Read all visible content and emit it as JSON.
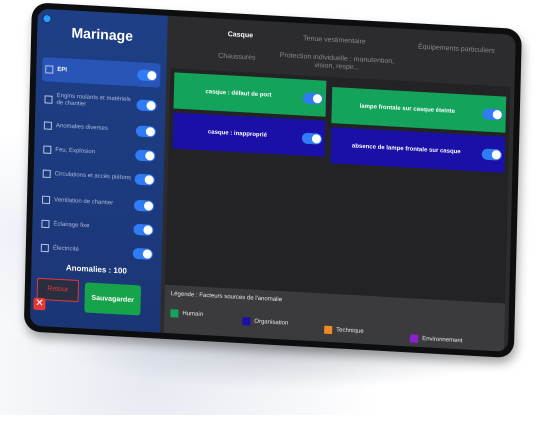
{
  "app": {
    "title": "Marinage"
  },
  "colors": {
    "sidebar_bg": "#1e3f86",
    "accent": "#2f7cf6",
    "humain": "#14a35a",
    "organisation": "#1a10a8",
    "technique": "#f08a24",
    "environnement": "#8e1ed6",
    "retour": "#e53935",
    "save": "#16a34a"
  },
  "sidebar": {
    "categories": [
      {
        "label": "EPI",
        "enabled": true
      },
      {
        "label": "Engins roulants et matériels de chantier",
        "enabled": true
      },
      {
        "label": "Anomalies diverses",
        "enabled": true
      },
      {
        "label": "Feu, Explosion",
        "enabled": true
      },
      {
        "label": "Circulations et accès piétons",
        "enabled": true
      },
      {
        "label": "Ventilation de chantier",
        "enabled": true
      },
      {
        "label": "Éclairage fixe",
        "enabled": true
      },
      {
        "label": "Électricité",
        "enabled": true
      }
    ],
    "anomalies_count": "Anomalies : 100",
    "back_label": "Retour",
    "save_label": "Sauvagarder"
  },
  "tabs": [
    {
      "label": "Casque",
      "active": true
    },
    {
      "label": "Tenue vestimentaire",
      "active": false
    },
    {
      "label": "Équipements particuliers",
      "active": false
    },
    {
      "label": "Chaussures",
      "active": false
    },
    {
      "label": "Protection individuelle : manutention, vision, respir...",
      "active": false
    }
  ],
  "anomalies": [
    {
      "label": "casque : défaut de port",
      "factor": "humain",
      "enabled": true
    },
    {
      "label": "lampe frontale sur casque éteinte",
      "factor": "humain",
      "enabled": true
    },
    {
      "label": "casque : inapproprié",
      "factor": "organisation",
      "enabled": true
    },
    {
      "label": "absence de lampe frontale sur casque",
      "factor": "organisation",
      "enabled": true
    }
  ],
  "legend": {
    "title": "Légende : Facteurs sources de l'anomalie",
    "items": [
      {
        "label": "Humain",
        "color": "#14a35a"
      },
      {
        "label": "Organisation",
        "color": "#1a10a8"
      },
      {
        "label": "Technique",
        "color": "#f08a24"
      },
      {
        "label": "Environnement",
        "color": "#8e1ed6"
      }
    ]
  }
}
